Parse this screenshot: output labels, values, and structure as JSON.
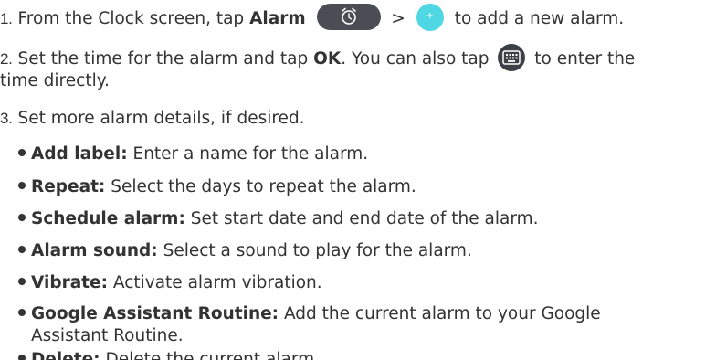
{
  "steps": [
    {
      "num": "1.",
      "pre": "From the Clock screen, tap",
      "bold": "Alarm",
      "sep": ">",
      "post": "to add a new alarm."
    },
    {
      "num": "2.",
      "pre": "Set the time for the alarm and tap",
      "bold": "OK",
      "mid": ". You can also tap",
      "post": "to enter the",
      "cont": "time directly."
    },
    {
      "num": "3.",
      "text": "Set more alarm details, if desired."
    }
  ],
  "bullets": [
    {
      "label": "Add label:",
      "text": "Enter a name for the alarm."
    },
    {
      "label": "Repeat:",
      "text": "Select the days to repeat the alarm."
    },
    {
      "label": "Schedule alarm:",
      "text": "Set start date and end date of the alarm."
    },
    {
      "label": "Alarm sound:",
      "text": "Select a sound to play for the alarm."
    },
    {
      "label": "Vibrate:",
      "text": "Activate alarm vibration."
    },
    {
      "label": "Google Assistant Routine:",
      "text": "Add the current alarm to your Google",
      "cont": "Assistant Routine."
    },
    {
      "label": "Delete:",
      "text": "Delete the current alarm."
    }
  ],
  "icons": {
    "alarm_tab": "alarm-clock-icon",
    "add": "plus-icon",
    "plus_glyph": "+",
    "keyboard": "keyboard-icon"
  },
  "colors": {
    "text": "#333333",
    "alarm_pill": "#4a4e54",
    "add_button": "#4fd8e3",
    "keyboard_button": "#3d4046"
  }
}
